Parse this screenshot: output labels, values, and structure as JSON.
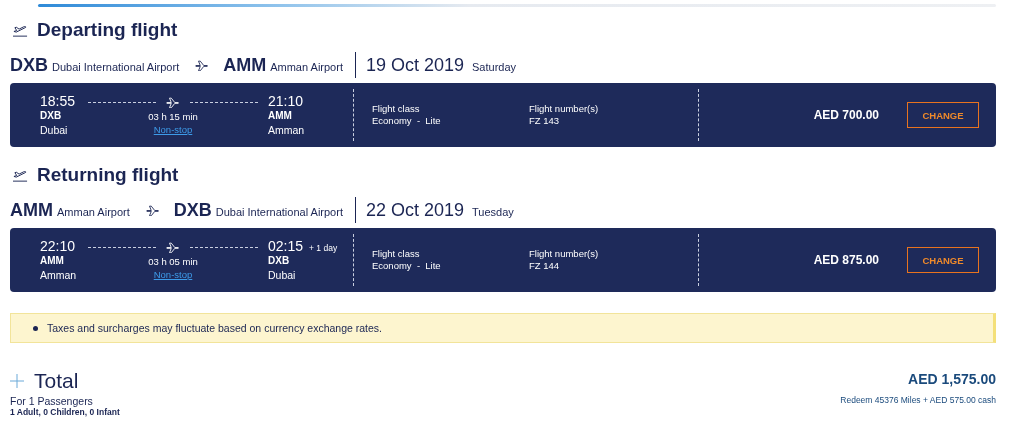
{
  "flights": [
    {
      "heading": "Departing flight",
      "origin": {
        "code": "DXB",
        "name": "Dubai International Airport"
      },
      "destination": {
        "code": "AMM",
        "name": "Amman Airport"
      },
      "date": "19 Oct 2019",
      "weekday": "Saturday",
      "departure": {
        "time": "18:55",
        "code": "DXB",
        "city": "Dubai"
      },
      "arrival": {
        "time": "21:10",
        "code": "AMM",
        "city": "Amman"
      },
      "duration": "03 h 15 min",
      "stops": "Non-stop",
      "class_label": "Flight class",
      "class_value": "Economy  -  Lite",
      "number_label": "Flight number(s)",
      "number_value": "FZ 143",
      "price": "AED 700.00",
      "button": "CHANGE"
    },
    {
      "heading": "Returning flight",
      "origin": {
        "code": "AMM",
        "name": "Amman Airport"
      },
      "destination": {
        "code": "DXB",
        "name": "Dubai International Airport"
      },
      "date": "22 Oct 2019",
      "weekday": "Tuesday",
      "departure": {
        "time": "22:10",
        "code": "AMM",
        "city": "Amman"
      },
      "arrival": {
        "time": "02:15",
        "code": "DXB",
        "city": "Dubai"
      },
      "day_offset": "+ 1 day",
      "duration": "03 h 05 min",
      "stops": "Non-stop",
      "class_label": "Flight class",
      "class_value": "Economy  -  Lite",
      "number_label": "Flight number(s)",
      "number_value": "FZ 144",
      "price": "AED 875.00",
      "button": "CHANGE"
    }
  ],
  "notice": {
    "items": [
      "Taxes and surcharges may fluctuate based on currency exchange rates."
    ]
  },
  "total": {
    "title": "Total",
    "passengers": "For 1 Passengers",
    "breakdown": "1 Adult, 0 Children, 0 Infant",
    "price": "AED 1,575.00",
    "redeem": "Redeem 45376 Miles + AED 575.00 cash"
  }
}
